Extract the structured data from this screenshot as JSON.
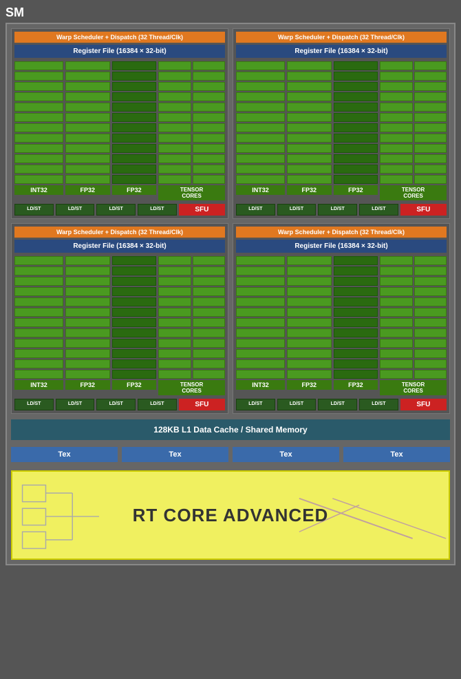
{
  "sm_label": "SM",
  "warp_scheduler": "Warp Scheduler + Dispatch (32 Thread/Clk)",
  "register_file": "Register File (16384 × 32-bit)",
  "core_labels": {
    "int32": "INT32",
    "fp32_1": "FP32",
    "fp32_2": "FP32",
    "tensor": "TENSOR\nCORES"
  },
  "ldst": "LD/ST",
  "sfu": "SFU",
  "l1_cache": "128KB L1 Data Cache / Shared Memory",
  "tex": "Tex",
  "rt_core": "RT CORE ADVANCED",
  "colors": {
    "orange": "#e07820",
    "blue_dark": "#2a4a7f",
    "green_dark": "#2a6a10",
    "green_mid": "#4a9a20",
    "teal": "#2a5a6a",
    "red": "#cc2222",
    "blue_tex": "#3a6aaa",
    "yellow": "#f0f060"
  }
}
